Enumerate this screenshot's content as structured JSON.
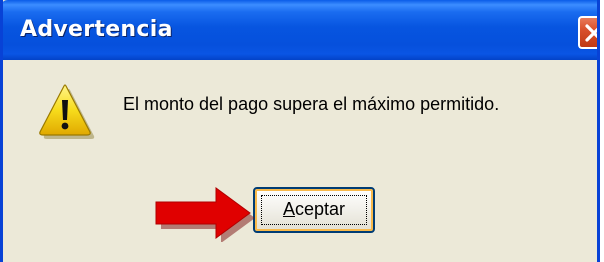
{
  "dialog": {
    "title": "Advertencia",
    "message": "El monto del pago supera el máximo permitido.",
    "accept_label_mnemonic": "A",
    "accept_label_rest": "ceptar",
    "icon": "warning-icon",
    "close_icon": "close-icon",
    "annotation_arrow": "red-arrow-icon"
  },
  "colors": {
    "titlebar": "#0755e0",
    "body": "#ece9d8",
    "close_button": "#d9502c",
    "arrow": "#e00000",
    "warning": "#f5d800"
  }
}
